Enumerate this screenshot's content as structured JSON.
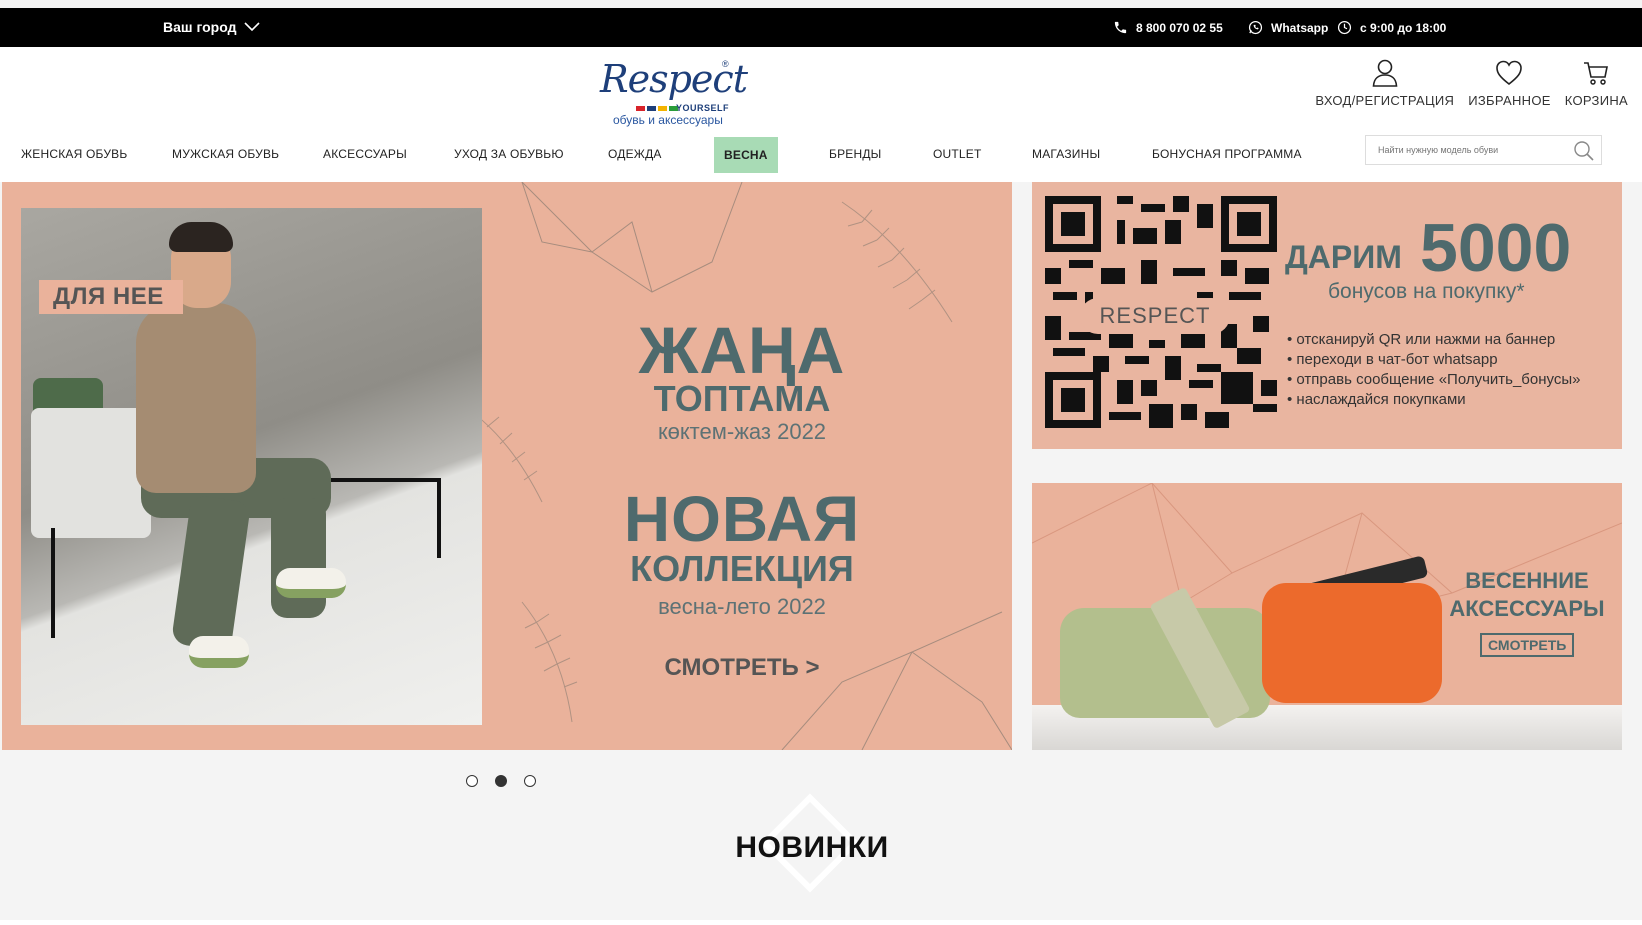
{
  "topbar": {
    "city": "Ваш город",
    "phone": "8 800 070 02 55",
    "whatsapp": "Whatsapp",
    "hours": "с 9:00 до 18:00"
  },
  "logo": {
    "script": "Respect",
    "yourself": "YOURSELF",
    "tagline": "обувь и аксессуары",
    "stripe_colors": [
      "#d8232a",
      "#1e3f7a",
      "#f4b400",
      "#2a9d3a",
      "#1e3f7a"
    ]
  },
  "user_actions": {
    "login": "ВХОД/РЕГИСТРАЦИЯ",
    "favorites": "ИЗБРАННОЕ",
    "cart": "КОРЗИНА"
  },
  "nav": [
    "ЖЕНСКАЯ ОБУВЬ",
    "МУЖСКАЯ ОБУВЬ",
    "АКСЕССУАРЫ",
    "УХОД ЗА ОБУВЬЮ",
    "ОДЕЖДА",
    "ВЕСНА",
    "БРЕНДЫ",
    "OUTLET",
    "МАГАЗИНЫ",
    "БОНУСНАЯ ПРОГРАММА"
  ],
  "search": {
    "placeholder": "Найти нужную модель обуви"
  },
  "hero": {
    "badge": "ДЛЯ НЕЕ",
    "line1": "ЖАҢА",
    "line2": "ТОПТАМА",
    "line3": "көктем-жаз 2022",
    "line4": "НОВАЯ",
    "line5": "КОЛЛЕКЦИЯ",
    "line6": "весна-лето 2022",
    "cta": "СМОТРЕТЬ >"
  },
  "promo_bonus": {
    "qr_label": "RESPECT",
    "darim": "ДАРИМ",
    "amount": "5000",
    "subtitle": "бонусов на покупку*",
    "steps": [
      "отсканируй QR или нажми на баннер",
      "переходи в чат-бот whatsapp",
      "отправь сообщение «Получить_бонусы»",
      "наслаждайся покупками"
    ]
  },
  "promo_accessories": {
    "line1": "ВЕСЕННИЕ",
    "line2": "АКСЕССУАРЫ",
    "cta": "СМОТРЕТЬ"
  },
  "slider": {
    "total": 3,
    "active": 2
  },
  "section": {
    "title": "НОВИНКИ"
  },
  "colors": {
    "accent_green": "#a8dbb5",
    "banner_peach": "#eab29b",
    "banner_text": "#4e6a6d"
  }
}
